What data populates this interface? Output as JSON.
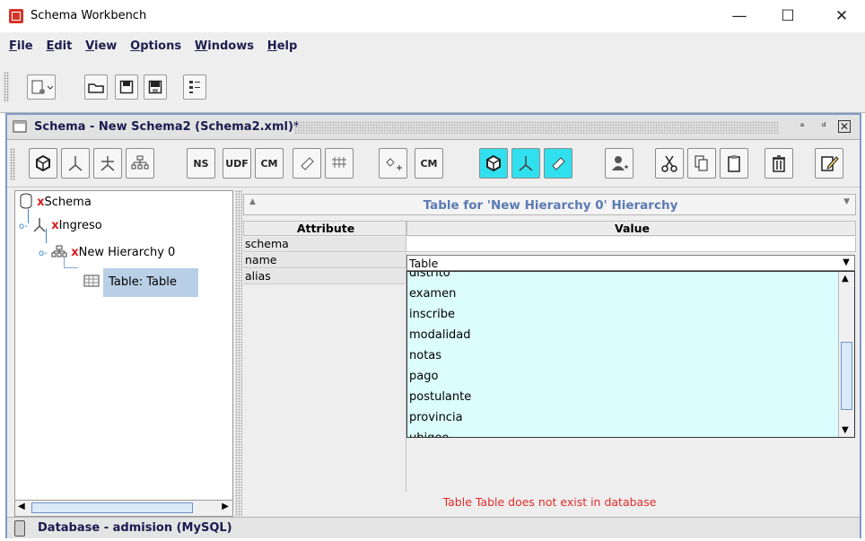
{
  "window": {
    "title": "Schema Workbench",
    "minimize": "—",
    "maximize": "☐",
    "close": "✕"
  },
  "menu": [
    {
      "first": "F",
      "rest": "ile"
    },
    {
      "first": "E",
      "rest": "dit"
    },
    {
      "first": "V",
      "rest": "iew"
    },
    {
      "first": "O",
      "rest": "ptions"
    },
    {
      "first": "W",
      "rest": "indows"
    },
    {
      "first": "H",
      "rest": "elp"
    }
  ],
  "frame": {
    "title": "Schema - New Schema2 (Schema2.xml)*",
    "toolbar_labels": {
      "ns": "NS",
      "udf": "UDF",
      "cm": "CM",
      "cm2": "CM",
      "plus": "+"
    }
  },
  "tree": {
    "schema": {
      "x": "x",
      "label": "Schema"
    },
    "cube": {
      "x": "x",
      "label": "Ingreso"
    },
    "hierarchy": {
      "x": "x",
      "label": "New Hierarchy 0"
    },
    "table": {
      "label": "Table: Table"
    }
  },
  "panel": {
    "title": "Table for 'New Hierarchy 0' Hierarchy",
    "col_attribute": "Attribute",
    "col_value": "Value",
    "rows": [
      {
        "attribute": "schema",
        "value": ""
      },
      {
        "attribute": "name",
        "value": "Table"
      },
      {
        "attribute": "alias",
        "value": ""
      }
    ],
    "dropdown_items": [
      "distrito",
      "examen",
      "inscribe",
      "modalidad",
      "notas",
      "pago",
      "postulante",
      "provincia",
      "ubigeo"
    ],
    "status": "Table Table does not exist in database"
  },
  "statusbar": {
    "text": "Database - admision (MySQL)"
  },
  "colors": {
    "accent": "#5b7ab3",
    "error": "#e32a2a",
    "selection": "#b8cfe6",
    "dropdown_bg": "#dcfdfd"
  }
}
